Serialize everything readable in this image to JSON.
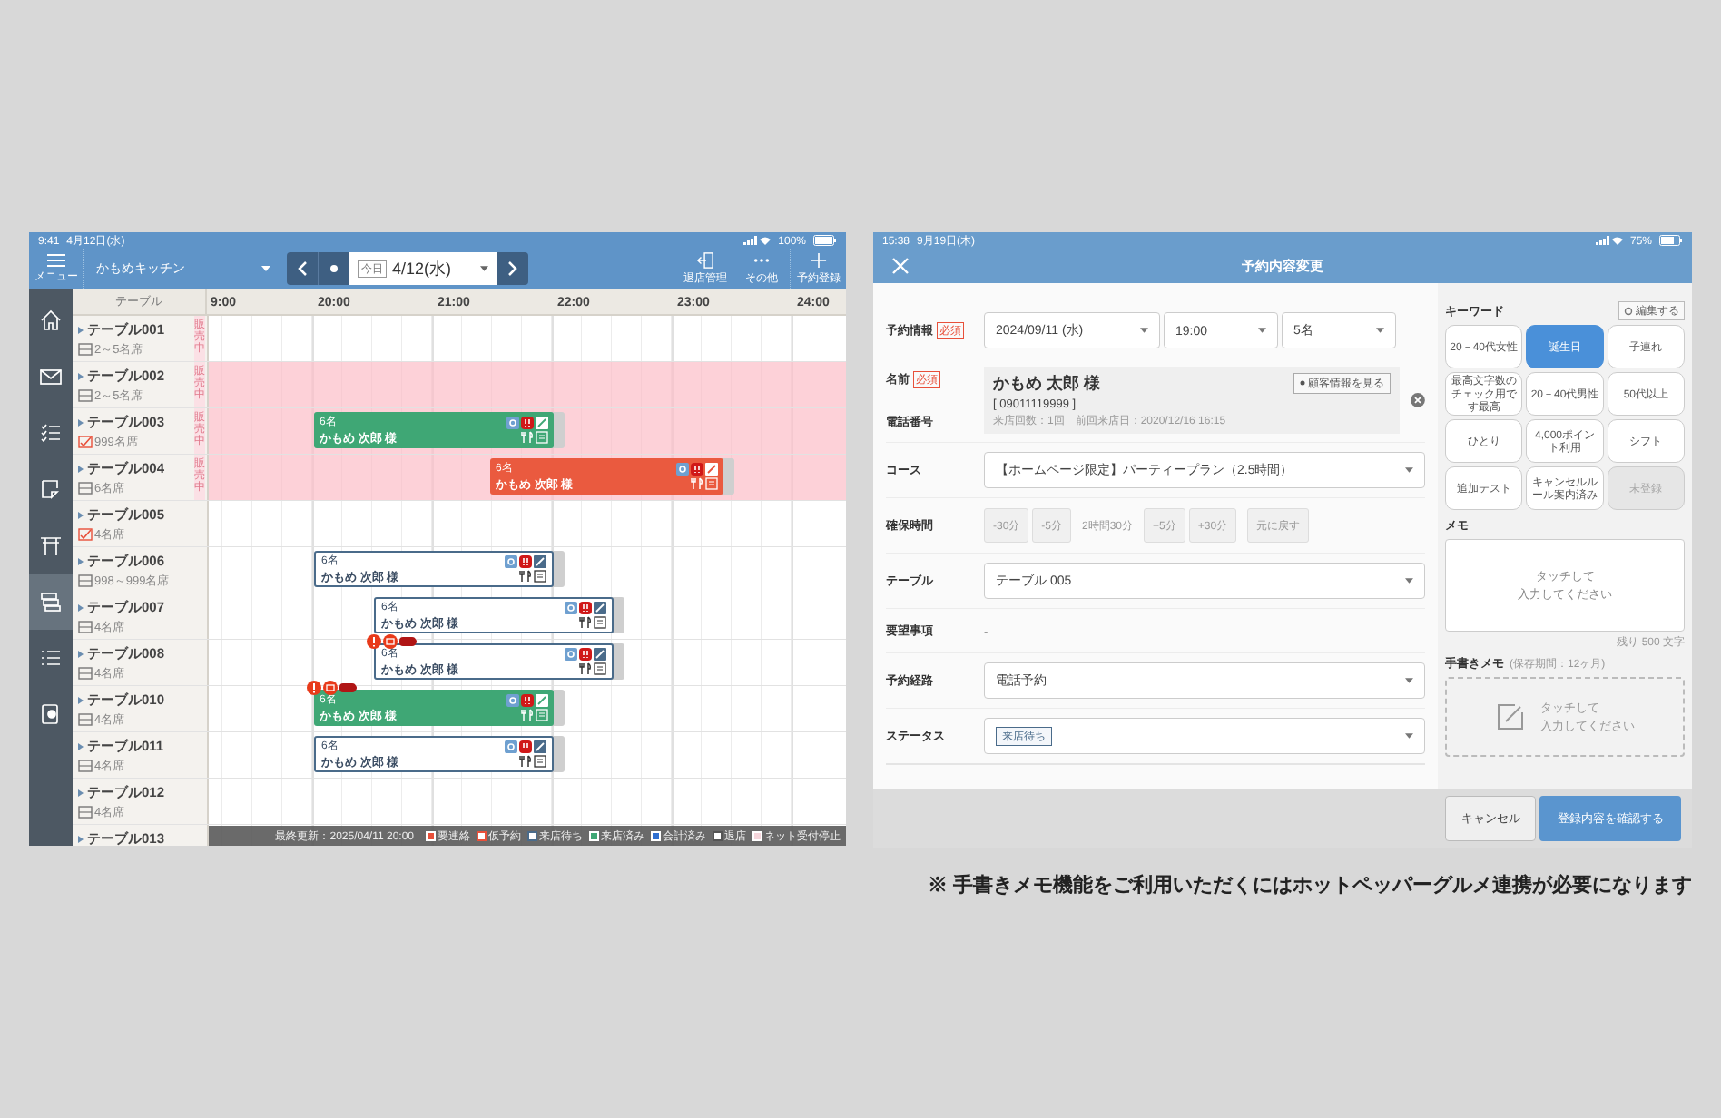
{
  "seat_screen": {
    "status_bar": {
      "time": "9:41",
      "date": "4月12日(水)",
      "battery": "100%"
    },
    "header": {
      "menu_label": "メニュー",
      "shop": "かもめキッチン",
      "today_badge": "今日",
      "date": "4/12(水)",
      "actions": [
        {
          "kind": "exit",
          "label": "退店管理"
        },
        {
          "kind": "more",
          "label": "その他"
        },
        {
          "kind": "add",
          "label": "予約登録"
        }
      ]
    },
    "sidebar": [
      {
        "kind": "home",
        "selected": false
      },
      {
        "kind": "mail",
        "selected": false
      },
      {
        "kind": "checklist",
        "selected": false
      },
      {
        "kind": "note",
        "selected": false
      },
      {
        "kind": "gate",
        "selected": false
      },
      {
        "kind": "layers",
        "selected": true
      },
      {
        "kind": "list",
        "selected": false
      },
      {
        "kind": "book",
        "selected": false
      }
    ],
    "table_header": "テーブル",
    "hours": [
      "9:00",
      "20:00",
      "21:00",
      "22:00",
      "23:00",
      "24:00"
    ],
    "rows": [
      {
        "name": "テーブル001",
        "seats": "2～5名席",
        "flagged": false,
        "tag": "販売中",
        "closed": false,
        "reservations": []
      },
      {
        "name": "テーブル002",
        "seats": "2～5名席",
        "flagged": false,
        "tag": "販売中",
        "closed": true,
        "reservations": []
      },
      {
        "name": "テーブル003",
        "seats": "999名席",
        "flagged": true,
        "tag": "販売中",
        "closed": true,
        "reservations": [
          {
            "kind": "seated",
            "party": "6名",
            "name": "かもめ 次郎 様",
            "alerts": false
          }
        ]
      },
      {
        "name": "テーブル004",
        "seats": "6名席",
        "flagged": false,
        "tag": "販売中",
        "closed": true,
        "reservations": [
          {
            "kind": "contact",
            "party": "6名",
            "name": "かもめ 次郎 様",
            "alerts": false
          }
        ]
      },
      {
        "name": "テーブル005",
        "seats": "4名席",
        "flagged": true,
        "closed": false,
        "reservations": []
      },
      {
        "name": "テーブル006",
        "seats": "998～999名席",
        "flagged": false,
        "closed": false,
        "reservations": [
          {
            "kind": "waiting",
            "party": "6名",
            "name": "かもめ 次郎 様",
            "alerts": false
          }
        ]
      },
      {
        "name": "テーブル007",
        "seats": "4名席",
        "flagged": false,
        "closed": false,
        "reservations": [
          {
            "kind": "waiting",
            "party": "6名",
            "name": "かもめ 次郎 様",
            "alerts": false
          }
        ]
      },
      {
        "name": "テーブル008",
        "seats": "4名席",
        "flagged": false,
        "closed": false,
        "reservations": [
          {
            "kind": "waiting",
            "party": "6名",
            "name": "かもめ 次郎 様",
            "alerts": true
          }
        ]
      },
      {
        "name": "テーブル010",
        "seats": "4名席",
        "flagged": false,
        "closed": false,
        "reservations": [
          {
            "kind": "seated",
            "party": "6名",
            "name": "かもめ 次郎 様",
            "alerts": true
          }
        ]
      },
      {
        "name": "テーブル011",
        "seats": "4名席",
        "flagged": false,
        "closed": false,
        "reservations": [
          {
            "kind": "waiting",
            "party": "6名",
            "name": "かもめ 次郎 様",
            "alerts": false
          }
        ]
      },
      {
        "name": "テーブル012",
        "seats": "4名席",
        "flagged": false,
        "closed": false,
        "reservations": []
      },
      {
        "name": "テーブル013",
        "closed": false,
        "reservations": []
      }
    ],
    "footer": {
      "updated": "最終更新：2025/04/11 20:00",
      "legend": [
        {
          "label": "要連絡",
          "color": "#e8503a",
          "outline": false
        },
        {
          "label": "仮予約",
          "color": "#e8503a",
          "outline": true
        },
        {
          "label": "来店待ち",
          "color": "#4a6b8a",
          "outline": true
        },
        {
          "label": "来店済み",
          "color": "#3fa775",
          "outline": false
        },
        {
          "label": "会計済み",
          "color": "#2f6fd0",
          "outline": false
        },
        {
          "label": "退店",
          "color": "#555555",
          "outline": true
        },
        {
          "label": "ネット受付停止",
          "color": "#f6d6dc",
          "outline": false
        }
      ]
    }
  },
  "edit_screen": {
    "status_bar": {
      "time": "15:38",
      "date": "9月19日(木)",
      "battery": "75%"
    },
    "title": "予約内容変更",
    "form": {
      "reserve_label": "予約情報",
      "required": "必須",
      "date": "2024/09/11 (水)",
      "time": "19:00",
      "party": "5名",
      "name_label": "名前",
      "name_required": "必須",
      "phone_label": "電話番号",
      "customer": {
        "name": "かもめ 太郎 様",
        "phone": "[ 09011119999 ]",
        "history": "来店回数：1回　前回来店日：2020/12/16 16:15",
        "button": "顧客情報を見る"
      },
      "course_label": "コース",
      "course": "【ホームページ限定】パーティープラン（2.5時間）",
      "duration_label": "確保時間",
      "minus_buttons": [
        "-30分",
        "-5分"
      ],
      "duration": "2時間30分",
      "plus_buttons": [
        "+5分",
        "+30分"
      ],
      "reset": "元に戻す",
      "table_label": "テーブル",
      "table": "テーブル 005",
      "request_label": "要望事項",
      "request": "-",
      "route_label": "予約経路",
      "route": "電話予約",
      "status_label": "ステータス",
      "status": "来店待ち"
    },
    "keywords": {
      "label": "キーワード",
      "edit": "編集する",
      "items": [
        {
          "label": "20－40代女性",
          "selected": false,
          "disabled": false
        },
        {
          "label": "誕生日",
          "selected": true,
          "disabled": false
        },
        {
          "label": "子連れ",
          "selected": false,
          "disabled": false
        },
        {
          "label": "最高文字数のチェック用です最高",
          "selected": false,
          "disabled": false
        },
        {
          "label": "20－40代男性",
          "selected": false,
          "disabled": false
        },
        {
          "label": "50代以上",
          "selected": false,
          "disabled": false
        },
        {
          "label": "ひとり",
          "selected": false,
          "disabled": false
        },
        {
          "label": "4,000ポイント利用",
          "selected": false,
          "disabled": false
        },
        {
          "label": "シフト",
          "selected": false,
          "disabled": false
        },
        {
          "label": "追加テスト",
          "selected": false,
          "disabled": false
        },
        {
          "label": "キャンセルルール案内済み",
          "selected": false,
          "disabled": false
        },
        {
          "label": "未登録",
          "selected": false,
          "disabled": true
        }
      ]
    },
    "memo": {
      "label": "メモ",
      "placeholder": [
        "タッチして",
        "入力してください"
      ],
      "remaining": "残り 500 文字"
    },
    "handwriting": {
      "label": "手書きメモ",
      "note": "(保存期間：12ヶ月)",
      "placeholder": [
        "タッチして",
        "入力してください"
      ]
    },
    "buttons": {
      "cancel": "キャンセル",
      "confirm": "登録内容を確認する"
    }
  },
  "caption": "※ 手書きメモ機能をご利用いただくにはホットペッパーグルメ連携が必要になります"
}
